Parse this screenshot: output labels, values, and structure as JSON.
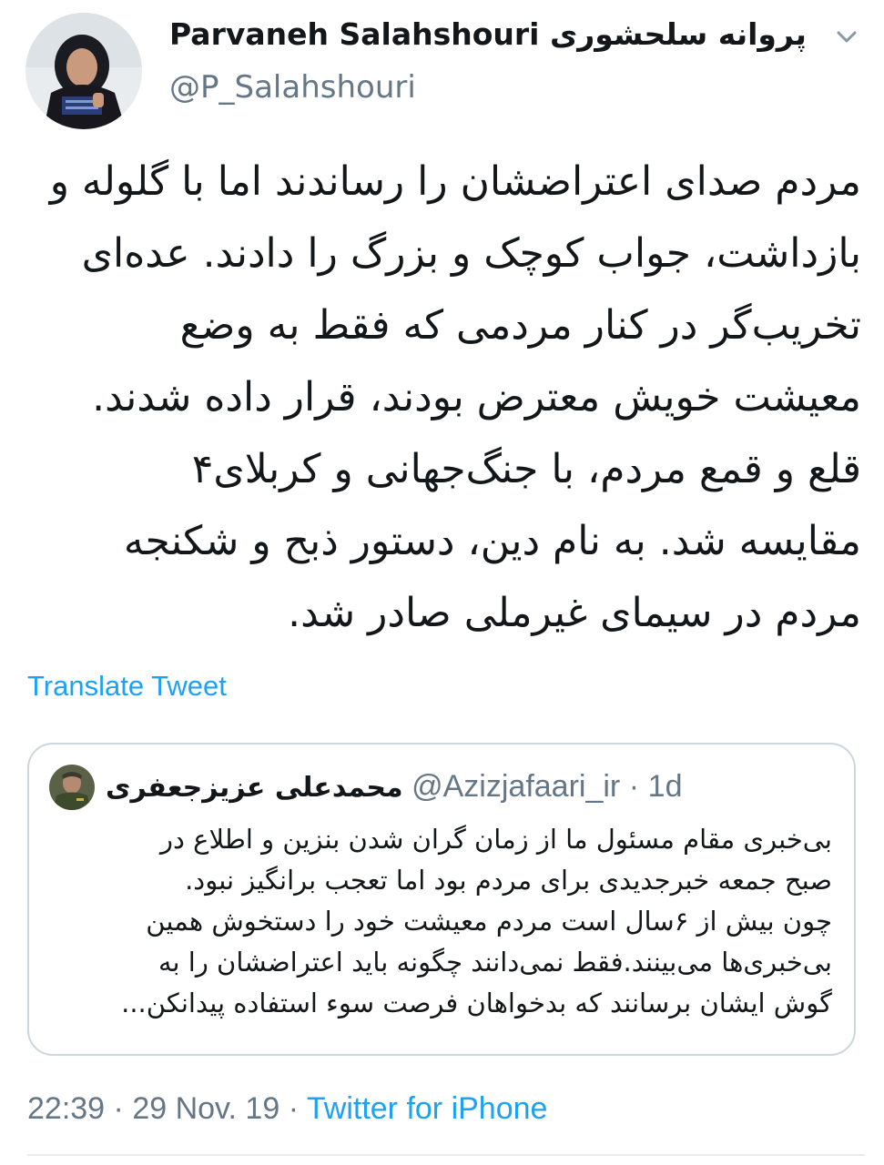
{
  "author": {
    "display_name": "Parvaneh Salahshouri",
    "display_name_fa": "پروانه سلحشوری",
    "handle": "@P_Salahshouri"
  },
  "icons": {
    "avatar": "profile-photo",
    "caret": "chevron-down-icon",
    "quote_avatar": "profile-photo"
  },
  "tweet": {
    "lines": [
      "مردم صدای اعتراضشان را رساندند اما با گلوله و",
      "بازداشت، جواب کوچک و بزرگ را دادند. عده‌ای",
      "تخریب‌گر در کنار مردمی که فقط به وضع",
      "معیشت خویش معترض بودند، قرار داده شدند.",
      "قلع و قمع مردم، با جنگ‌جهانی و کربلای۴",
      "مقایسه شد. به نام دین، دستور ذبح و شکنجه",
      "مردم در سیمای غیرملی صادر شد."
    ],
    "translate_label": "Translate Tweet"
  },
  "quoted": {
    "name": "محمدعلی عزیزجعفری",
    "handle": "@Azizjafaari_ir",
    "separator": "·",
    "time": "1d",
    "lines": [
      "بی‌خبری مقام مسئول ما از زمان گران شدن بنزین و اطلاع در",
      "صبح جمعه خبرجدیدی برای مردم بود اما تعجب برانگیز نبود.",
      "چون بیش از ۶سال است مردم معیشت خود را دستخوش همین",
      "بی‌خبری‌ها می‌بینند.فقط نمی‌دانند چگونه باید اعتراضشان را به",
      "گوش ایشان برسانند که بدخواهان فرصت سوء استفاده پیدانکن..."
    ]
  },
  "footer": {
    "time": "22:39",
    "separator": "·",
    "date": "29 Nov. 19",
    "source": "Twitter for iPhone"
  },
  "colors": {
    "text": "#14171a",
    "secondary": "#657786",
    "link": "#1da1f2",
    "border": "#ccd6dd"
  }
}
